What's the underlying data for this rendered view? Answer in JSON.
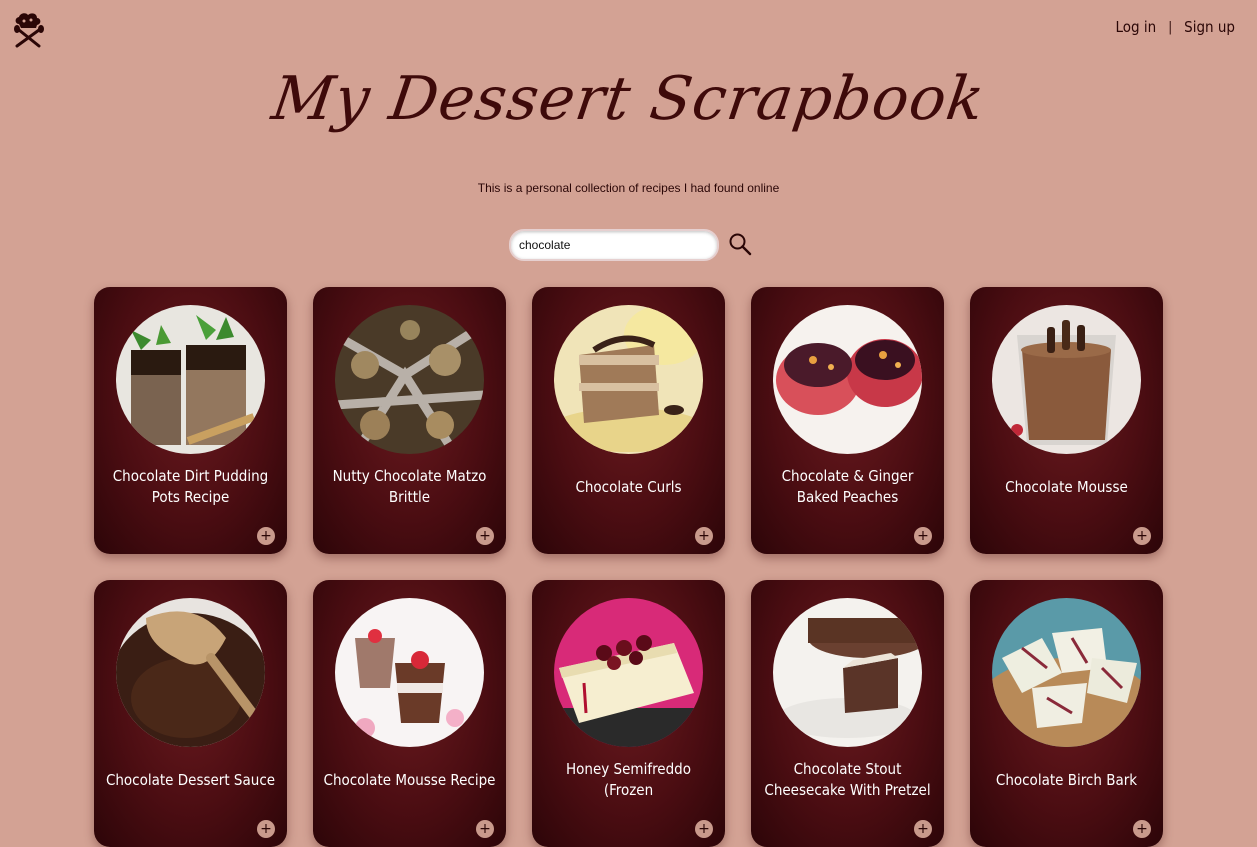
{
  "header": {
    "logo_icon": "chef-hat-spoon-icon",
    "login_label": "Log in",
    "separator": "|",
    "signup_label": "Sign up"
  },
  "site": {
    "title": "My Dessert Scrapbook",
    "subtitle": "This is a personal collection of recipes I had found online"
  },
  "search": {
    "value": "chocolate",
    "icon": "search-icon"
  },
  "colors": {
    "background": "#d3a294",
    "card": "#4b0d12",
    "title": "#3e0a0a"
  },
  "recipes": [
    {
      "title": "Chocolate Dirt Pudding Pots Recipe",
      "add_label": "+"
    },
    {
      "title": "Nutty Chocolate Matzo Brittle",
      "add_label": "+"
    },
    {
      "title": "Chocolate Curls",
      "add_label": "+"
    },
    {
      "title": "Chocolate & Ginger Baked Peaches",
      "add_label": "+"
    },
    {
      "title": "Chocolate Mousse",
      "add_label": "+"
    },
    {
      "title": "Chocolate Dessert Sauce",
      "add_label": "+"
    },
    {
      "title": "Chocolate Mousse Recipe",
      "add_label": "+"
    },
    {
      "title": "Honey Semifreddo (Frozen",
      "add_label": "+"
    },
    {
      "title": "Chocolate Stout Cheesecake With Pretzel",
      "add_label": "+"
    },
    {
      "title": "Chocolate Birch Bark",
      "add_label": "+"
    }
  ]
}
